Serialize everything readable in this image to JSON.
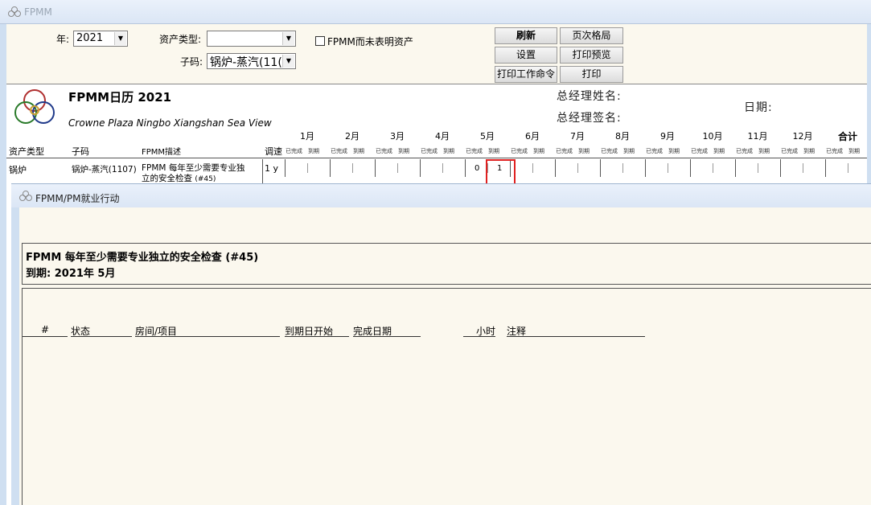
{
  "window": {
    "title": "FPMM"
  },
  "filters": {
    "year_label": "年:",
    "year_value": "2021",
    "asset_type_label": "资产类型:",
    "asset_type_value": "",
    "code_label": "子码:",
    "code_value": "锅炉-蒸汽(11(",
    "checkbox_label": "FPMM而未表明资产"
  },
  "buttons": {
    "refresh": "刷新",
    "page_layout": "页次格局",
    "settings": "设置",
    "print_preview": "打印预览",
    "print_work_order": "打印工作命令",
    "print": "打印"
  },
  "report": {
    "title": "FPMM日历 2021",
    "hotel": "Crowne Plaza Ningbo Xiangshan Sea View",
    "gm_name_label": "总经理姓名:",
    "gm_sign_label": "总经理签名:",
    "date_label": "日期:",
    "months": [
      "1月",
      "2月",
      "3月",
      "4月",
      "5月",
      "6月",
      "7月",
      "8月",
      "9月",
      "10月",
      "11月",
      "12月"
    ],
    "total_label": "合计",
    "sub_done": "已完成",
    "sub_due": "到期",
    "headers": {
      "asset_type": "资产类型",
      "code": "子码",
      "desc": "FPMM描述",
      "freq": "调速"
    },
    "row": {
      "asset_type": "锅炉",
      "code": "锅炉-蒸汽(1107)",
      "desc_line1": "FPMM 每年至少需要专业独",
      "desc_line2": "立的安全检查",
      "desc_suffix": "(#45)",
      "freq": "1 y",
      "may_done": "0",
      "may_due": "1"
    }
  },
  "dialog": {
    "title": "FPMM/PM就业行动",
    "heading": "FPMM 每年至少需要专业独立的安全检查 (#45)",
    "due": "到期: 2021年 5月",
    "columns": {
      "num": "#",
      "status": "状态",
      "room": "房间/项目",
      "due_start": "到期日开始",
      "done_date": "完成日期",
      "hours": "小时",
      "notes": "注释"
    }
  }
}
